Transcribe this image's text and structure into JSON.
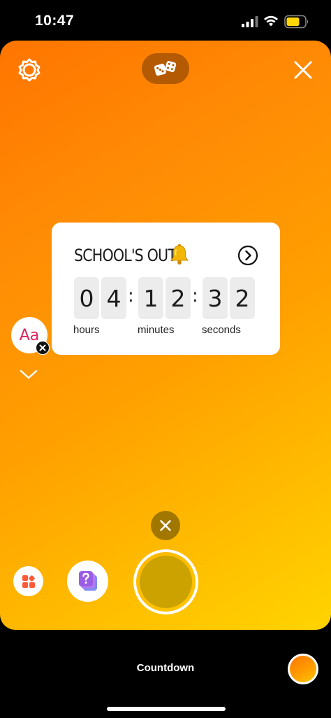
{
  "status_bar": {
    "time": "10:47"
  },
  "sticker": {
    "title": "SCHOOL'S OUT",
    "digits": [
      "0",
      "4",
      "1",
      "2",
      "3",
      "2"
    ],
    "separator": ":",
    "units": {
      "hours": "hours",
      "minutes": "minutes",
      "seconds": "seconds"
    }
  },
  "text_sticker": {
    "label": "Aa"
  },
  "bottom": {
    "mode_label": "Countdown"
  },
  "colors": {
    "gradient_start": "#ff7500",
    "gradient_end": "#ffd400",
    "dice_pill": "#b35a02",
    "shutter_fill": "#cca200",
    "question_badge": "#9b5de5",
    "layout_icon": "#ff5a36"
  },
  "icons": [
    "settings-icon",
    "dice-icon",
    "close-icon",
    "bell-icon",
    "arrow-right-circle-icon",
    "chevron-down-icon",
    "layout-icon",
    "question-sticker-icon"
  ]
}
